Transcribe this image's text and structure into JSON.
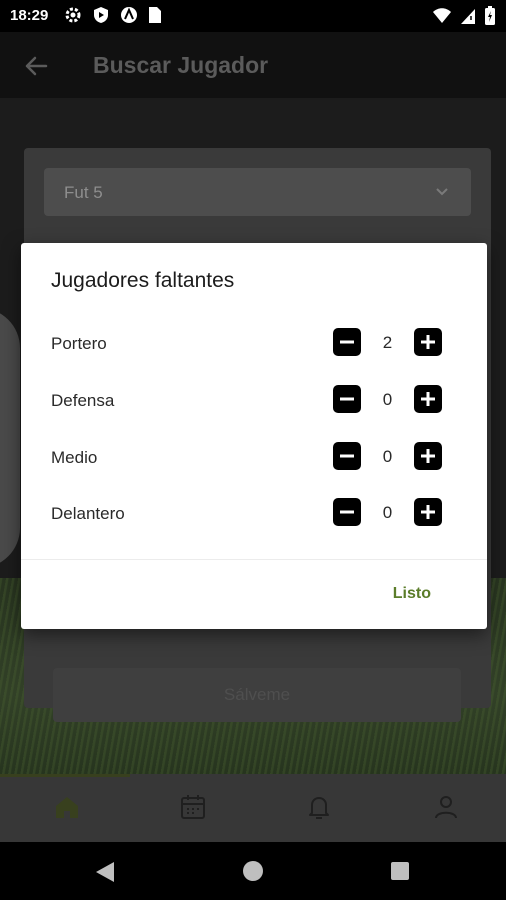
{
  "status_bar": {
    "time": "18:29",
    "left_icons": [
      "settings-icon",
      "shield-icon",
      "vpn-icon",
      "sim-card-icon"
    ],
    "right_icons": [
      "wifi-icon",
      "signal-icon",
      "battery-icon"
    ]
  },
  "app_bar": {
    "title": "Buscar Jugador",
    "back_icon": "arrow-left-icon"
  },
  "form": {
    "sport_select": {
      "value": "Fut 5",
      "icon": "chevron-down-icon"
    },
    "submit_label": "Sálveme"
  },
  "dialog": {
    "title": "Jugadores faltantes",
    "positions": [
      {
        "label": "Portero",
        "count": "2"
      },
      {
        "label": "Defensa",
        "count": "0"
      },
      {
        "label": "Medio",
        "count": "0"
      },
      {
        "label": "Delantero",
        "count": "0"
      }
    ],
    "done_label": "Listo"
  },
  "bottom_nav": {
    "items": [
      "home-icon",
      "calendar-icon",
      "bell-icon",
      "person-icon"
    ],
    "active_item": "home-icon",
    "active_color": "#38401e"
  },
  "system_nav": [
    "back-triangle-icon",
    "home-circle-icon",
    "recents-square-icon"
  ],
  "colors": {
    "accent": "#5b7d2a",
    "stepper_button": "#000000",
    "dialog_background": "#ffffff"
  }
}
